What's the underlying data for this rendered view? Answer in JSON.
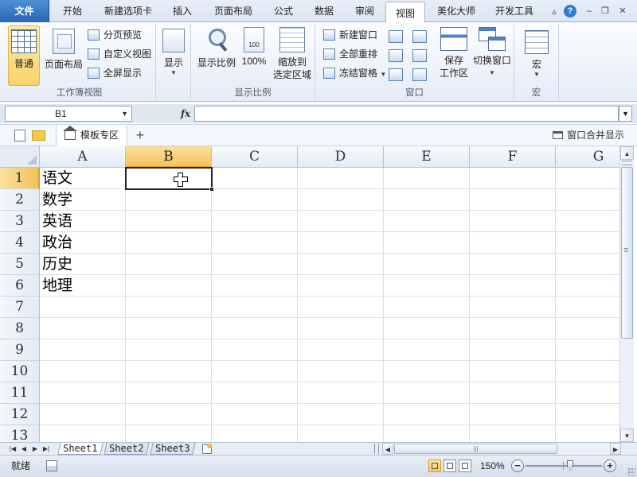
{
  "ribbon_tabs": [
    {
      "label": "文件",
      "kind": "file"
    },
    {
      "label": "开始"
    },
    {
      "label": "新建选项卡"
    },
    {
      "label": "插入"
    },
    {
      "label": "页面布局"
    },
    {
      "label": "公式"
    },
    {
      "label": "数据"
    },
    {
      "label": "审阅"
    },
    {
      "label": "视图",
      "active": true
    },
    {
      "label": "美化大师"
    },
    {
      "label": "开发工具"
    }
  ],
  "window_controls": {
    "help": "?",
    "minimize": "–",
    "restore": "❐",
    "close": "✕"
  },
  "ribbon": {
    "workbook_views": {
      "group_label": "工作簿视图",
      "normal": "普通",
      "page_layout": "页面布局",
      "page_break_preview": "分页预览",
      "custom_views": "自定义视图",
      "full_screen": "全屏显示"
    },
    "show": {
      "label": "显示"
    },
    "zoom": {
      "group_label": "显示比例",
      "zoom": "显示比例",
      "hundred": "100%",
      "hundred_icon_text": "100",
      "zoom_to_selection_line1": "缩放到",
      "zoom_to_selection_line2": "选定区域"
    },
    "window": {
      "group_label": "窗口",
      "new_window": "新建窗口",
      "arrange_all": "全部重排",
      "freeze_panes": "冻结窗格",
      "save_workspace_line1": "保存",
      "save_workspace_line2": "工作区",
      "switch_windows": "切换窗口"
    },
    "macros": {
      "group_label": "宏",
      "label": "宏"
    }
  },
  "formula_bar": {
    "name_box": "B1",
    "fx": "fx",
    "formula": ""
  },
  "workbook_tabs": {
    "template_tab": "模板专区",
    "add": "+",
    "merge_windows": "窗口合并显示"
  },
  "grid": {
    "columns": [
      "A",
      "B",
      "C",
      "D",
      "E",
      "F",
      "G"
    ],
    "rows": [
      "1",
      "2",
      "3",
      "4",
      "5",
      "6",
      "7",
      "8",
      "9",
      "10",
      "11",
      "12",
      "13"
    ],
    "selected_column": "B",
    "selected_row": "1",
    "active_cell": "B1",
    "cells": {
      "A1": "语文",
      "A2": "数学",
      "A3": "英语",
      "A4": "政治",
      "A5": "历史",
      "A6": "地理"
    }
  },
  "sheets": [
    {
      "label": "Sheet1",
      "active": true
    },
    {
      "label": "Sheet2"
    },
    {
      "label": "Sheet3"
    }
  ],
  "sheet_nav": [
    "|◀",
    "◀",
    "▶",
    "▶|"
  ],
  "status_bar": {
    "ready": "就绪",
    "zoom": "150%",
    "zoom_level": 150,
    "zoom_minus": "−",
    "zoom_plus": "+"
  },
  "colors": {
    "accent": "#2a67b8",
    "selection": "#f5c25a",
    "active_view_button": "#f8d36b"
  }
}
